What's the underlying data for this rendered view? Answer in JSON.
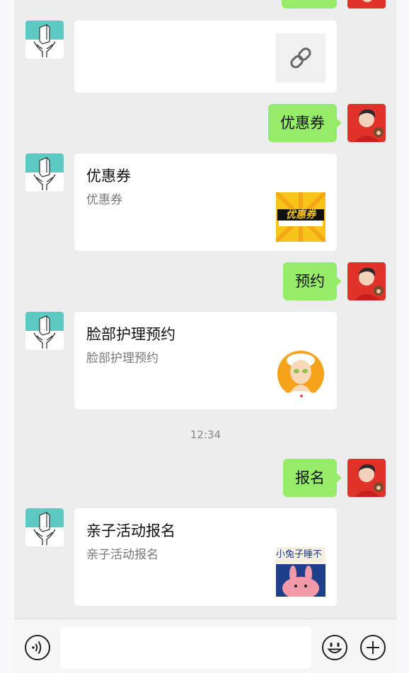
{
  "conversation": {
    "messages": [
      {
        "from": "user",
        "type": "text",
        "text": "优惠券"
      },
      {
        "from": "shop",
        "type": "card",
        "title": "优惠券",
        "desc": "优惠券",
        "thumb": "coupon-image",
        "thumb_text": "优惠券"
      },
      {
        "from": "user",
        "type": "text",
        "text": "预约"
      },
      {
        "from": "shop",
        "type": "card",
        "title": "脸部护理预约",
        "desc": "脸部护理预约",
        "thumb": "facial-mask-image"
      },
      {
        "from": "user",
        "type": "text",
        "text": "报名"
      },
      {
        "from": "shop",
        "type": "card",
        "title": "亲子活动报名",
        "desc": "亲子活动报名",
        "thumb": "rabbit-poster-image",
        "thumb_text": "小兔子睡不"
      }
    ],
    "timestamp": "12:34",
    "partial_top_card": {
      "thumb": "link-icon"
    }
  },
  "input_bar": {
    "icons": [
      "voice-icon",
      "emoji-icon",
      "plus-icon"
    ],
    "input_value": ""
  },
  "colors": {
    "chat_background": "#ededed",
    "sent_bubble": "#95ec69",
    "card_background": "#ffffff",
    "shop_avatar_teal": "#5cc9c2"
  }
}
